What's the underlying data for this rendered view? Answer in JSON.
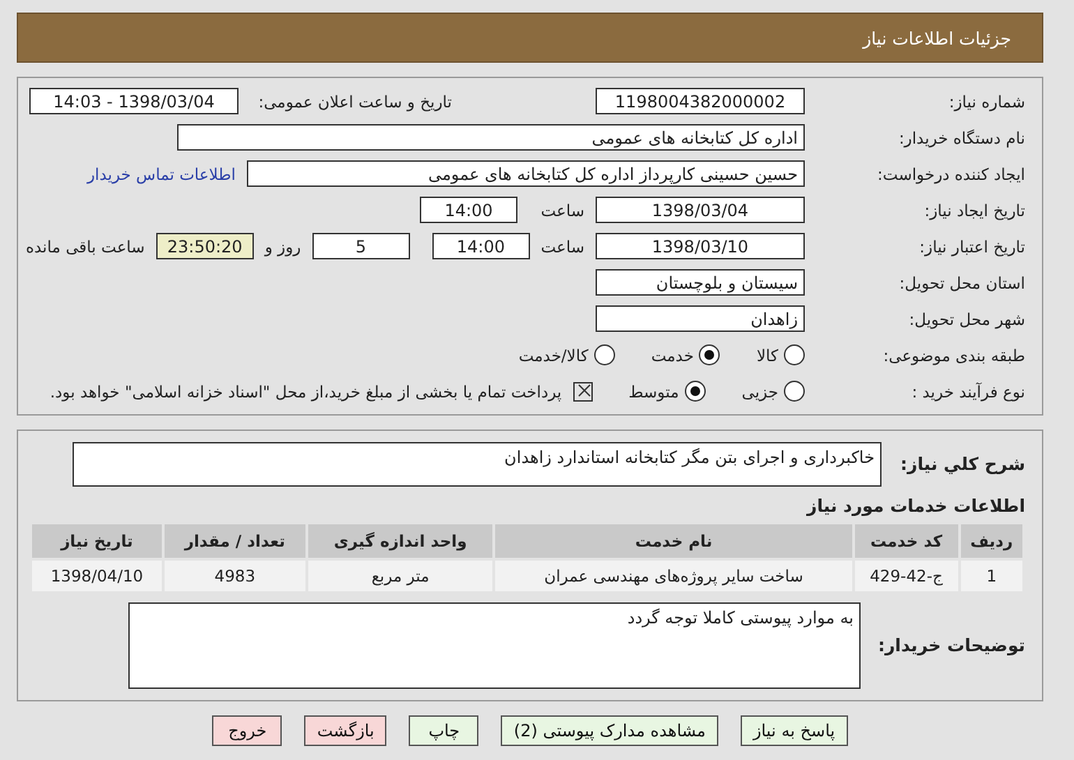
{
  "header": {
    "title": "جزئیات اطلاعات نیاز"
  },
  "need_number": {
    "label": "شماره نیاز:",
    "value": "1198004382000002"
  },
  "announce": {
    "label": "تاریخ و ساعت اعلان عمومی:",
    "value": "1398/03/04 - 14:03"
  },
  "buyer": {
    "label": "نام دستگاه خریدار:",
    "value": "اداره کل کتابخانه های عمومی"
  },
  "requester": {
    "label": "ایجاد کننده درخواست:",
    "value": "حسین حسینی کارپرداز اداره کل کتابخانه های عمومی",
    "link": "اطلاعات تماس خریدار"
  },
  "created": {
    "label": "تاریخ ایجاد نیاز:",
    "date": "1398/03/04",
    "time_label": "ساعت",
    "time": "14:00"
  },
  "validity": {
    "label": "تاریخ اعتبار نیاز:",
    "date": "1398/03/10",
    "time_label": "ساعت",
    "time": "14:00",
    "days": "5",
    "days_label": "روز و",
    "remaining": "23:50:20",
    "remaining_label": "ساعت باقی مانده"
  },
  "province": {
    "label": "استان محل تحویل:",
    "value": "سیستان و بلوچستان"
  },
  "city": {
    "label": "شهر محل تحویل:",
    "value": "زاهدان"
  },
  "category": {
    "label": "طبقه بندی موضوعی:",
    "options": [
      {
        "label": "کالا",
        "selected": false
      },
      {
        "label": "خدمت",
        "selected": true
      },
      {
        "label": "کالا/خدمت",
        "selected": false
      }
    ]
  },
  "process": {
    "label": "نوع فرآیند خرید :",
    "options": [
      {
        "label": "جزیی",
        "selected": false
      },
      {
        "label": "متوسط",
        "selected": true
      }
    ],
    "payment": {
      "checked": true,
      "label": "پرداخت تمام یا بخشی از مبلغ خرید،از محل \"اسناد خزانه اسلامی\" خواهد بود."
    }
  },
  "description": {
    "label": "شرح کلي نياز:",
    "value": "خاکبرداری و اجرای بتن مگر کتابخانه استاندارد زاهدان"
  },
  "services": {
    "title": "اطلاعات خدمات مورد نیاز",
    "columns": [
      "ردیف",
      "کد خدمت",
      "نام خدمت",
      "واحد اندازه گیری",
      "تعداد / مقدار",
      "تاریخ نیاز"
    ],
    "rows": [
      [
        "1",
        "ج-42-429",
        "ساخت سایر پروژه‌های مهندسی عمران",
        "متر مربع",
        "4983",
        "1398/04/10"
      ]
    ]
  },
  "notes": {
    "label": "توضیحات خریدار:",
    "value": "به موارد پیوستی کاملا توجه گردد"
  },
  "buttons": [
    {
      "label": "پاسخ به نیاز",
      "kind": "green"
    },
    {
      "label": "مشاهده مدارک پیوستی (2)",
      "kind": "green"
    },
    {
      "label": "چاپ",
      "kind": "green"
    },
    {
      "label": "بازگشت",
      "kind": "red"
    },
    {
      "label": "خروج",
      "kind": "red"
    }
  ]
}
